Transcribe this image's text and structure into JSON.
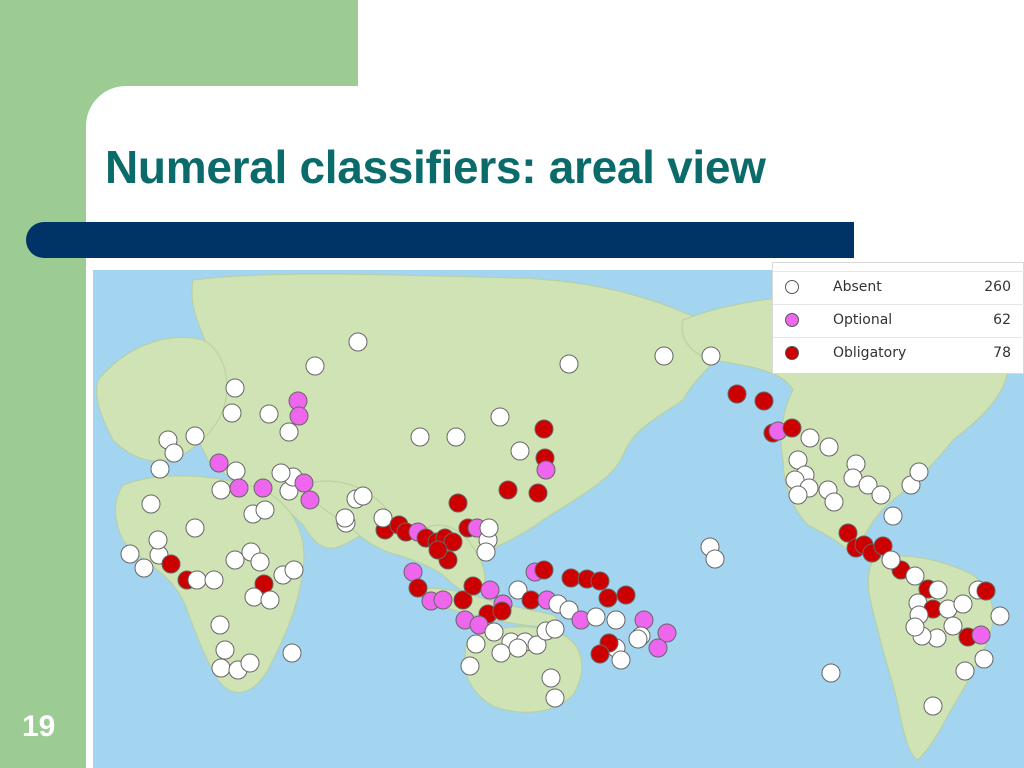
{
  "slide": {
    "title": "Numeral classifiers: areal view",
    "page_number": "19"
  },
  "legend": {
    "items": [
      {
        "label": "Absent",
        "count": "260",
        "color": "#ffffff"
      },
      {
        "label": "Optional",
        "count": "62",
        "color": "#ee66ee"
      },
      {
        "label": "Obligatory",
        "count": "78",
        "color": "#cc0000"
      }
    ]
  },
  "colors": {
    "absent": "#ffffff",
    "optional": "#ee66ee",
    "obligatory": "#cc0000",
    "ocean": "#a3d4f0",
    "accent_title": "#0b6b6b",
    "bar": "#003366",
    "slide_green": "#9ccb94"
  }
}
